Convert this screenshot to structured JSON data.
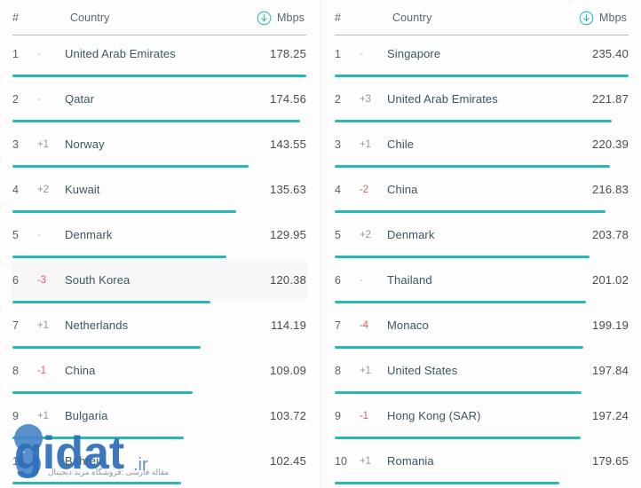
{
  "colors": {
    "bar": "#2bb6b6",
    "accent_icon": "#2bb6b6",
    "country_text": "#3d5561",
    "value_text": "#4a4a4a",
    "delta_down": "#e05c6e",
    "delta_flat": "#b9c0c6",
    "row_shaded": "#f7f7f7",
    "panel_bg": "#fdfdfd",
    "header_rule": "#7d7d7d"
  },
  "watermark": {
    "text": "gidat",
    "tld": ".ir",
    "subtitle": "مقاله فارسی :فروشگاه مرید دیجیتال"
  },
  "panels": [
    {
      "id": "left",
      "header": {
        "rank_label": "#",
        "country_label": "Country",
        "unit_label": "Mbps",
        "unit_icon": "download-circle-icon"
      },
      "max_value": 178.25,
      "rows": [
        {
          "rank": "1",
          "delta": "-",
          "delta_dir": "flat",
          "country": "United Arab Emirates",
          "value": "178.25",
          "bar_pct": 100.0,
          "shaded": false
        },
        {
          "rank": "2",
          "delta": "-",
          "delta_dir": "flat",
          "country": "Qatar",
          "value": "174.56",
          "bar_pct": 97.9,
          "shaded": false
        },
        {
          "rank": "3",
          "delta": "+1",
          "delta_dir": "up",
          "country": "Norway",
          "value": "143.55",
          "bar_pct": 80.5,
          "shaded": false
        },
        {
          "rank": "4",
          "delta": "+2",
          "delta_dir": "up",
          "country": "Kuwait",
          "value": "135.63",
          "bar_pct": 76.1,
          "shaded": false
        },
        {
          "rank": "5",
          "delta": "-",
          "delta_dir": "flat",
          "country": "Denmark",
          "value": "129.95",
          "bar_pct": 72.9,
          "shaded": false
        },
        {
          "rank": "6",
          "delta": "-3",
          "delta_dir": "down",
          "country": "South Korea",
          "value": "120.38",
          "bar_pct": 67.5,
          "shaded": true
        },
        {
          "rank": "7",
          "delta": "+1",
          "delta_dir": "up",
          "country": "Netherlands",
          "value": "114.19",
          "bar_pct": 64.1,
          "shaded": false
        },
        {
          "rank": "8",
          "delta": "-1",
          "delta_dir": "down",
          "country": "China",
          "value": "109.09",
          "bar_pct": 61.2,
          "shaded": false
        },
        {
          "rank": "9",
          "delta": "+1",
          "delta_dir": "up",
          "country": "Bulgaria",
          "value": "103.72",
          "bar_pct": 58.2,
          "shaded": false
        },
        {
          "rank": "10",
          "delta": "-",
          "delta_dir": "flat",
          "country": "Bahrein",
          "value": "102.45",
          "bar_pct": 57.5,
          "shaded": false
        }
      ]
    },
    {
      "id": "right",
      "header": {
        "rank_label": "#",
        "country_label": "Country",
        "unit_label": "Mbps",
        "unit_icon": "download-circle-icon"
      },
      "max_value": 235.4,
      "rows": [
        {
          "rank": "1",
          "delta": "-",
          "delta_dir": "flat",
          "country": "Singapore",
          "value": "235.40",
          "bar_pct": 100.0,
          "shaded": false
        },
        {
          "rank": "2",
          "delta": "+3",
          "delta_dir": "up",
          "country": "United Arab Emirates",
          "value": "221.87",
          "bar_pct": 94.3,
          "shaded": false
        },
        {
          "rank": "3",
          "delta": "+1",
          "delta_dir": "up",
          "country": "Chile",
          "value": "220.39",
          "bar_pct": 93.6,
          "shaded": false
        },
        {
          "rank": "4",
          "delta": "-2",
          "delta_dir": "down",
          "country": "China",
          "value": "216.83",
          "bar_pct": 92.1,
          "shaded": false
        },
        {
          "rank": "5",
          "delta": "+2",
          "delta_dir": "up",
          "country": "Denmark",
          "value": "203.78",
          "bar_pct": 86.6,
          "shaded": false
        },
        {
          "rank": "6",
          "delta": "-",
          "delta_dir": "flat",
          "country": "Thailand",
          "value": "201.02",
          "bar_pct": 85.4,
          "shaded": false
        },
        {
          "rank": "7",
          "delta": "-4",
          "delta_dir": "down",
          "country": "Monaco",
          "value": "199.19",
          "bar_pct": 84.6,
          "shaded": false
        },
        {
          "rank": "8",
          "delta": "+1",
          "delta_dir": "up",
          "country": "United States",
          "value": "197.84",
          "bar_pct": 84.1,
          "shaded": false
        },
        {
          "rank": "9",
          "delta": "-1",
          "delta_dir": "down",
          "country": "Hong Kong (SAR)",
          "value": "197.24",
          "bar_pct": 83.8,
          "shaded": false
        },
        {
          "rank": "10",
          "delta": "+1",
          "delta_dir": "up",
          "country": "Romania",
          "value": "179.65",
          "bar_pct": 76.3,
          "shaded": false
        }
      ]
    }
  ]
}
